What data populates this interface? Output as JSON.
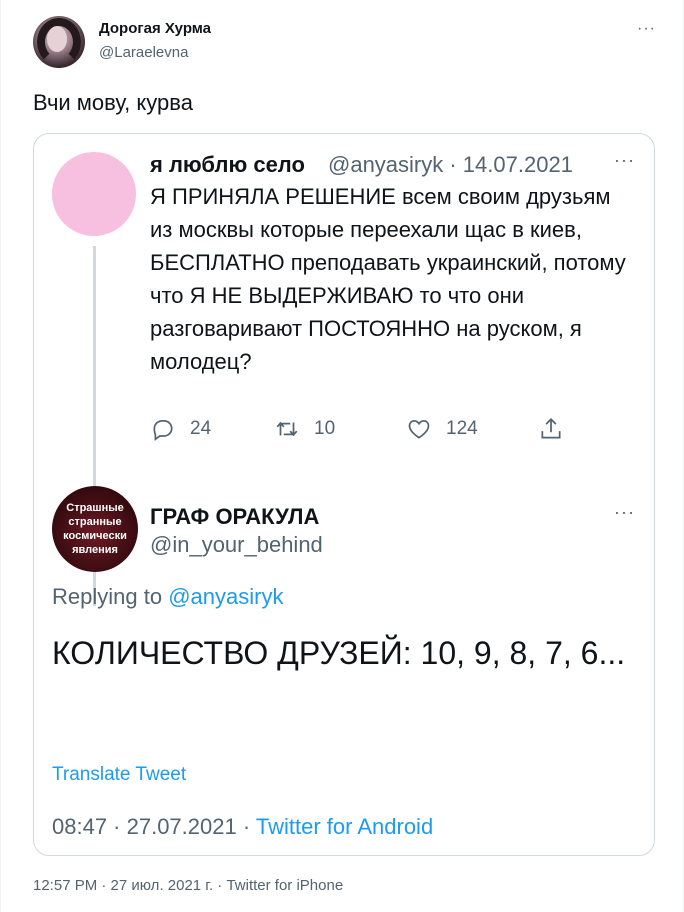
{
  "tweet": {
    "author_name": "Дорогая Хурма",
    "author_handle": "@Laraelevna",
    "more_icon": "more-dots-icon",
    "text": "Вчи мову, курва",
    "footer": "12:57 PM · 27 июл. 2021 г. · Twitter for iPhone"
  },
  "quoted_tweet": {
    "author_name": "я люблю село",
    "meta": "@anyasiryk · 14.07.2021",
    "text": "Я ПРИНЯЛА РЕШЕНИЕ всем своим друзьям из москвы которые переехали щас в киев, БЕСПЛАТНО преподавать украинский, потому что Я НЕ ВЫДЕРЖИВАЮ то что они разговаривают ПОСТОЯННО на руском, я молодец?",
    "actions": {
      "replies": "24",
      "retweets": "10",
      "likes": "124"
    }
  },
  "reply": {
    "avatar_text": [
      "Страшные",
      "странные",
      "космически",
      "явления"
    ],
    "author_name": "ГРАФ ОРАКУЛА",
    "author_handle": "@in_your_behind",
    "replying_prefix": "Replying to",
    "replying_mention": "@anyasiryk",
    "text": "КОЛИЧЕСТВО ДРУЗЕЙ: 10, 9, 8, 7, 6...",
    "translate_label": "Translate Tweet",
    "timestamp": "08:47 · 27.07.2021 · ",
    "source": "Twitter for Android"
  },
  "colors": {
    "accent": "#1d9bf0",
    "secondary_text": "#536471",
    "border": "#cfd9de",
    "quoted_avatar": "#f7bfe0"
  }
}
